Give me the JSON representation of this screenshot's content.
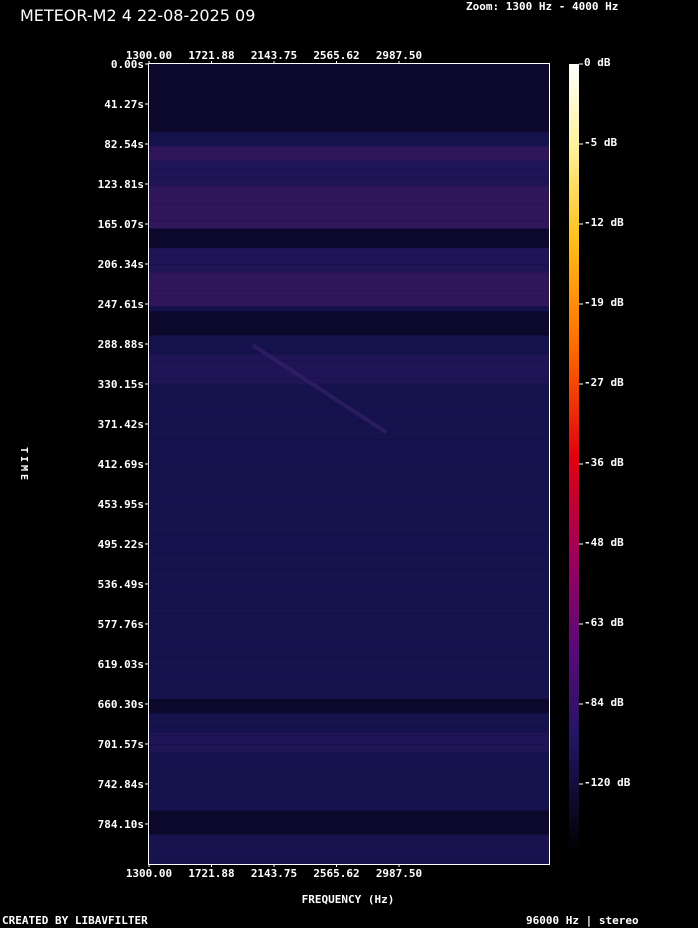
{
  "header": {
    "title": "METEOR-M2 4 22-08-2025 09",
    "zoom": "Zoom: 1300 Hz - 4000 Hz"
  },
  "footer": {
    "left": "CREATED BY LIBAVFILTER",
    "right": "96000 Hz | stereo"
  },
  "chart_data": {
    "type": "heatmap",
    "title": "METEOR-M2 4 22-08-2025 09",
    "xlabel": "FREQUENCY (Hz)",
    "ylabel": "TIME",
    "x_ticks": [
      "1300.00",
      "1721.88",
      "2143.75",
      "2565.62",
      "2987.50"
    ],
    "y_ticks": [
      "0.00s",
      "41.27s",
      "82.54s",
      "123.81s",
      "165.07s",
      "206.34s",
      "247.61s",
      "288.88s",
      "330.15s",
      "371.42s",
      "412.69s",
      "453.95s",
      "495.22s",
      "536.49s",
      "577.76s",
      "619.03s",
      "660.30s",
      "701.57s",
      "742.84s",
      "784.10s"
    ],
    "xlim": [
      1300,
      4000
    ],
    "ylim_s": [
      0,
      825.4
    ],
    "colorbar": {
      "labels": [
        "0 dB",
        "-5 dB",
        "-12 dB",
        "-19 dB",
        "-27 dB",
        "-36 dB",
        "-48 dB",
        "-63 dB",
        "-84 dB",
        "-120 dB"
      ]
    },
    "colors": {
      "background": "#000000",
      "plot_base": "#16124e",
      "plot_dark": "#0a0828",
      "plot_purple": "#3a1860",
      "text": "#ffffff"
    },
    "bands": [
      {
        "t0": 0,
        "t1": 70,
        "level": "dark"
      },
      {
        "t0": 85,
        "t1": 100,
        "level": "bright"
      },
      {
        "t0": 100,
        "t1": 125,
        "level": "mid"
      },
      {
        "t0": 125,
        "t1": 170,
        "level": "bright"
      },
      {
        "t0": 170,
        "t1": 190,
        "level": "dark"
      },
      {
        "t0": 190,
        "t1": 215,
        "level": "mid"
      },
      {
        "t0": 215,
        "t1": 250,
        "level": "bright"
      },
      {
        "t0": 255,
        "t1": 280,
        "level": "dark"
      },
      {
        "t0": 300,
        "t1": 330,
        "level": "mid"
      },
      {
        "t0": 655,
        "t1": 670,
        "level": "dark"
      },
      {
        "t0": 690,
        "t1": 710,
        "level": "mid"
      },
      {
        "t0": 770,
        "t1": 795,
        "level": "dark"
      },
      {
        "t0": 795,
        "t1": 825,
        "level": "base"
      }
    ],
    "signal_trace": {
      "f0": 2000,
      "t0": 290,
      "f1": 2900,
      "t1": 380
    }
  }
}
